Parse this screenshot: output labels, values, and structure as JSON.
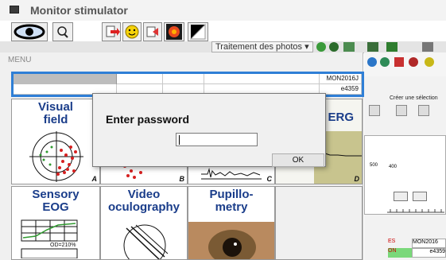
{
  "window": {
    "title": "Monitor stimulator"
  },
  "toolbar2": {
    "photos_label": "Traitement des photos"
  },
  "menu": {
    "label": "MENU",
    "header_cells": {
      "code": "MON2016J",
      "number": "e4359"
    }
  },
  "tiles": [
    {
      "id": "visual-field",
      "label_line1": "Visual",
      "label_line2": "field",
      "letter": "A"
    },
    {
      "id": "b",
      "label_line1": "",
      "label_line2": "",
      "letter": "B"
    },
    {
      "id": "c",
      "label_line1": "",
      "label_line2": "",
      "letter": "C"
    },
    {
      "id": "erg",
      "label_line1": "ERG",
      "label_line2": "",
      "letter": "D"
    },
    {
      "id": "sensory-eog",
      "label_line1": "Sensory",
      "label_line2": "EOG",
      "caption": "OD=210%"
    },
    {
      "id": "video-oculography",
      "label_line1": "Video",
      "label_line2": "oculography"
    },
    {
      "id": "pupillometry",
      "label_line1": "Pupillo-",
      "label_line2": "metry"
    }
  ],
  "right_panel": {
    "create_selection": "Créer une sélection",
    "axis_500": "500",
    "axis_400": "400",
    "bottom_es": "ES",
    "bottom_on": "ON",
    "bottom_code": "MON2016",
    "bottom_num": "e4359"
  },
  "dialog": {
    "title": "Enter password",
    "password_value": "",
    "ok_label": "OK"
  }
}
